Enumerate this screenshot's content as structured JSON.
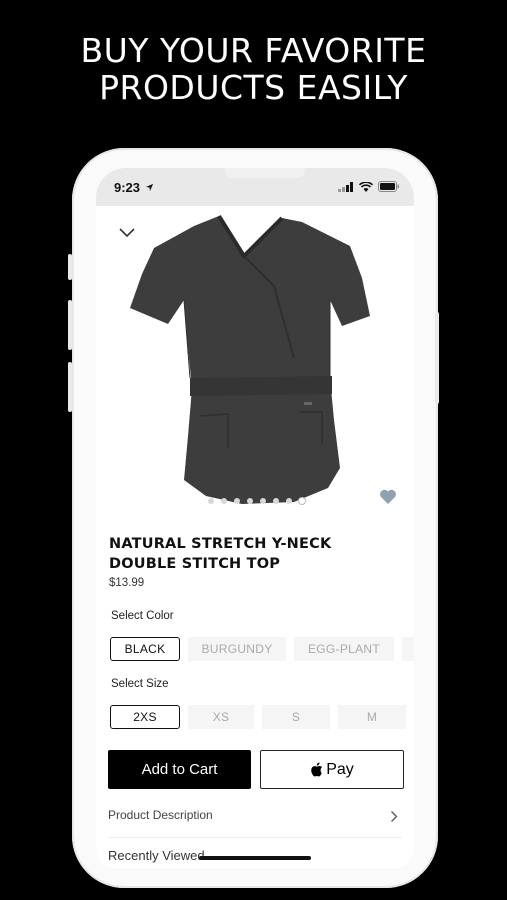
{
  "headline": {
    "line1": "BUY YOUR FAVORITE",
    "line2": "PRODUCTS EASILY"
  },
  "status_bar": {
    "time": "9:23",
    "icons": [
      "location-arrow-icon",
      "signal-icon",
      "wifi-icon",
      "battery-icon"
    ]
  },
  "product": {
    "title": "NATURAL STRETCH Y-NECK DOUBLE STITCH TOP",
    "price": "$13.99",
    "image_dots": {
      "count": 8,
      "active_index": 7
    }
  },
  "color": {
    "label": "Select Color",
    "options": [
      "BLACK",
      "BURGUNDY",
      "EGG-PLANT"
    ],
    "selected": "BLACK"
  },
  "size": {
    "label": "Select Size",
    "options": [
      "2XS",
      "XS",
      "S",
      "M"
    ],
    "selected": "2XS"
  },
  "actions": {
    "add_to_cart": "Add to Cart",
    "apple_pay": "Pay"
  },
  "sections": {
    "description": "Product Description",
    "recently_viewed": "Recently Viewed"
  },
  "colors": {
    "background": "#000000",
    "accent": "#000000",
    "heart": "#8fa2b0"
  }
}
